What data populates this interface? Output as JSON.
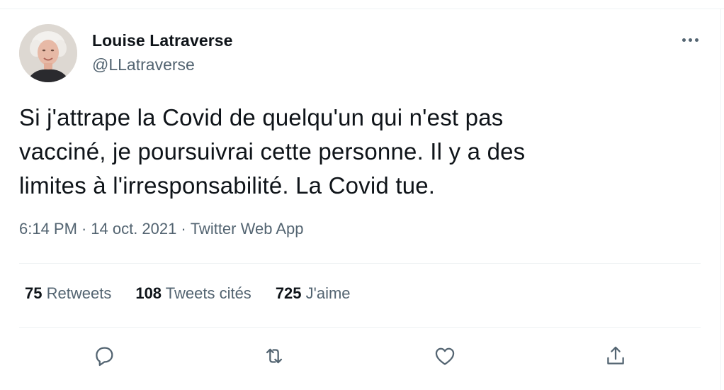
{
  "author": {
    "display_name": "Louise Latraverse",
    "handle": "@LLatraverse",
    "avatar_icon": "profile-photo"
  },
  "tweet": {
    "text_lines": [
      "Si j'attrape la Covid de quelqu'un qui n'est pas",
      "vacciné, je poursuivrai cette personne. Il y a des",
      "limites à l'irresponsabilité. La Covid tue."
    ],
    "time": "6:14 PM",
    "separator": "·",
    "date": "14 oct. 2021",
    "source": "Twitter Web App"
  },
  "stats": {
    "retweets_count": "75",
    "retweets_label": "Retweets",
    "quotes_count": "108",
    "quotes_label": "Tweets cités",
    "likes_count": "725",
    "likes_label": "J'aime"
  },
  "actions": [
    {
      "name": "reply",
      "icon": "speech-bubble-icon"
    },
    {
      "name": "retweet",
      "icon": "retweet-icon"
    },
    {
      "name": "like",
      "icon": "heart-icon"
    },
    {
      "name": "share",
      "icon": "share-icon"
    }
  ],
  "colors": {
    "text_primary": "#0f1419",
    "text_secondary": "#536471",
    "divider": "#eff3f4"
  }
}
